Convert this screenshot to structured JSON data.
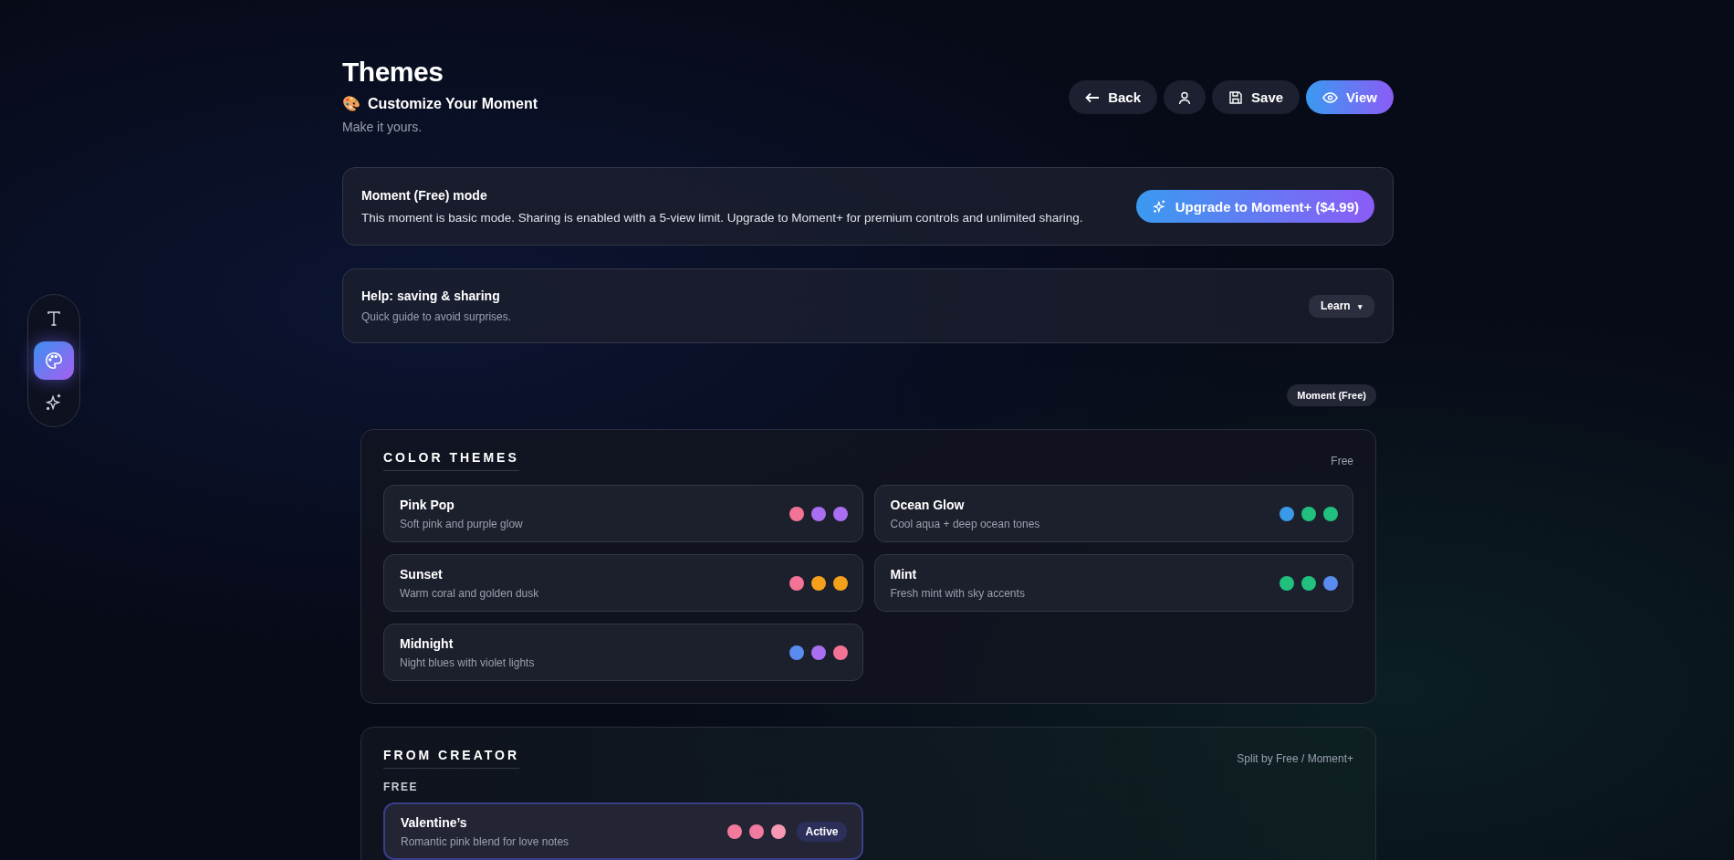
{
  "sidebar": {
    "tools": [
      {
        "kind": "text",
        "selected": false
      },
      {
        "kind": "palette",
        "selected": true
      },
      {
        "kind": "sparkle",
        "selected": false
      }
    ]
  },
  "header": {
    "title": "Themes",
    "emoji": "🎨",
    "subtitle": "Customize Your Moment",
    "tagline": "Make it yours.",
    "actions": [
      {
        "kind": "back",
        "label": "Back"
      },
      {
        "kind": "profile"
      },
      {
        "kind": "save",
        "label": "Save"
      },
      {
        "kind": "view",
        "label": "View"
      }
    ]
  },
  "mode_banner": {
    "title": "Moment (Free) mode",
    "text": "This moment is basic mode. Sharing is enabled with a 5-view limit. Upgrade to Moment+ for premium controls and unlimited sharing.",
    "button": "Upgrade to Moment+ ($4.99)"
  },
  "help": {
    "title": "Help: saving & sharing",
    "text": "Quick guide to avoid surprises.",
    "button": "Learn",
    "caret": "▾"
  },
  "plan_badge": "Moment (Free)",
  "sections": [
    {
      "title": "COLOR THEMES",
      "note": "Free",
      "groups": [
        {
          "themes": [
            {
              "name": "Pink Pop",
              "description": "Soft pink and purple glow",
              "active": false,
              "swatches": [
                {
                  "color": "#f27395"
                },
                {
                  "color": "#a96ff0"
                },
                {
                  "color": "#a96ff0"
                }
              ]
            },
            {
              "name": "Ocean Glow",
              "description": "Cool aqua + deep ocean tones",
              "active": false,
              "swatches": [
                {
                  "color": "#3b9ae8"
                },
                {
                  "color": "#22c07f"
                },
                {
                  "color": "#22c07f"
                }
              ]
            },
            {
              "name": "Sunset",
              "description": "Warm coral and golden dusk",
              "active": false,
              "swatches": [
                {
                  "color": "#f27395"
                },
                {
                  "color": "#f5a01b"
                },
                {
                  "color": "#f5a01b"
                }
              ]
            },
            {
              "name": "Mint",
              "description": "Fresh mint with sky accents",
              "active": false,
              "swatches": [
                {
                  "color": "#22c07f"
                },
                {
                  "color": "#22c07f"
                },
                {
                  "color": "#5a8cf0"
                }
              ]
            },
            {
              "name": "Midnight",
              "description": "Night blues with violet lights",
              "active": false,
              "swatches": [
                {
                  "color": "#5a8cf0"
                },
                {
                  "color": "#a96ff0"
                },
                {
                  "color": "#f27395"
                }
              ]
            }
          ]
        }
      ]
    },
    {
      "title": "FROM CREATOR",
      "note": "Split by Free / Moment+",
      "groups": [
        {
          "label": "FREE",
          "themes": [
            {
              "name": "Valentine’s",
              "description": "Romantic pink blend for love notes",
              "active": true,
              "badge": "Active",
              "swatches": [
                {
                  "color": "#f47a9b"
                },
                {
                  "color": "#f27a9e"
                },
                {
                  "color": "#f598b4"
                }
              ]
            }
          ]
        }
      ]
    }
  ]
}
